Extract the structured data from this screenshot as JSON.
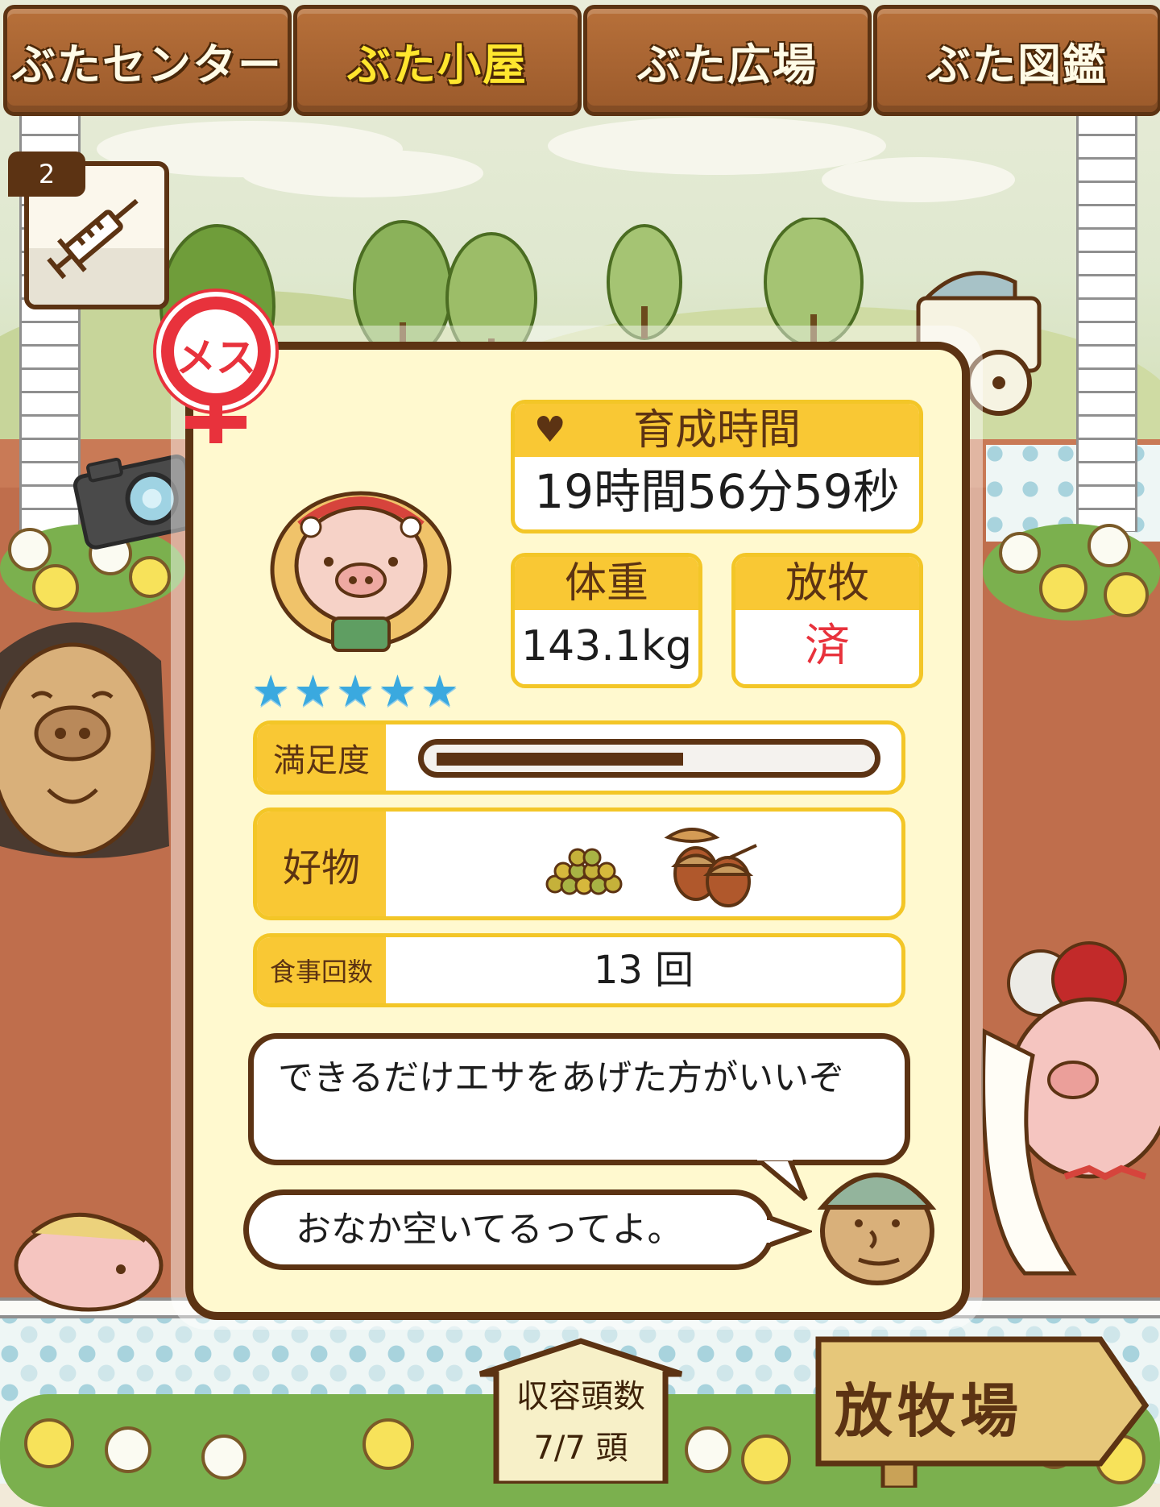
{
  "tabs": [
    {
      "label": "ぶたセンター",
      "active": false
    },
    {
      "label": "ぶた小屋",
      "active": true
    },
    {
      "label": "ぶた広場",
      "active": false
    },
    {
      "label": "ぶた図鑑",
      "active": false
    }
  ],
  "item": {
    "count": "2",
    "icon": "syringe-icon"
  },
  "pig": {
    "gender_label": "メス",
    "rarity_stars": 5,
    "stars_text": "★★★★★"
  },
  "stats": {
    "growth_time_label": "育成時間",
    "growth_time_value": "19時間56分59秒",
    "weight_label": "体重",
    "weight_value": "143.1kg",
    "grazing_label": "放牧",
    "grazing_value": "済"
  },
  "satisfaction": {
    "label": "満足度",
    "level": 0.58
  },
  "favorites": {
    "label": "好物",
    "items": [
      "grain-pile-icon",
      "acorn-icon"
    ]
  },
  "meals": {
    "label": "食事回数",
    "value": "13 回"
  },
  "messages": {
    "advice": "できるだけエサをあげた方がいいぞ",
    "status": "おなか空いてるってよ。"
  },
  "capacity": {
    "label": "収容頭数",
    "value": "7/7 頭"
  },
  "pasture_sign": {
    "label": "放牧場"
  },
  "colors": {
    "brown": "#5c3313",
    "yellow": "#f9c834",
    "panel": "#fff9cf",
    "star": "#3aa9df",
    "red": "#e8323c"
  }
}
